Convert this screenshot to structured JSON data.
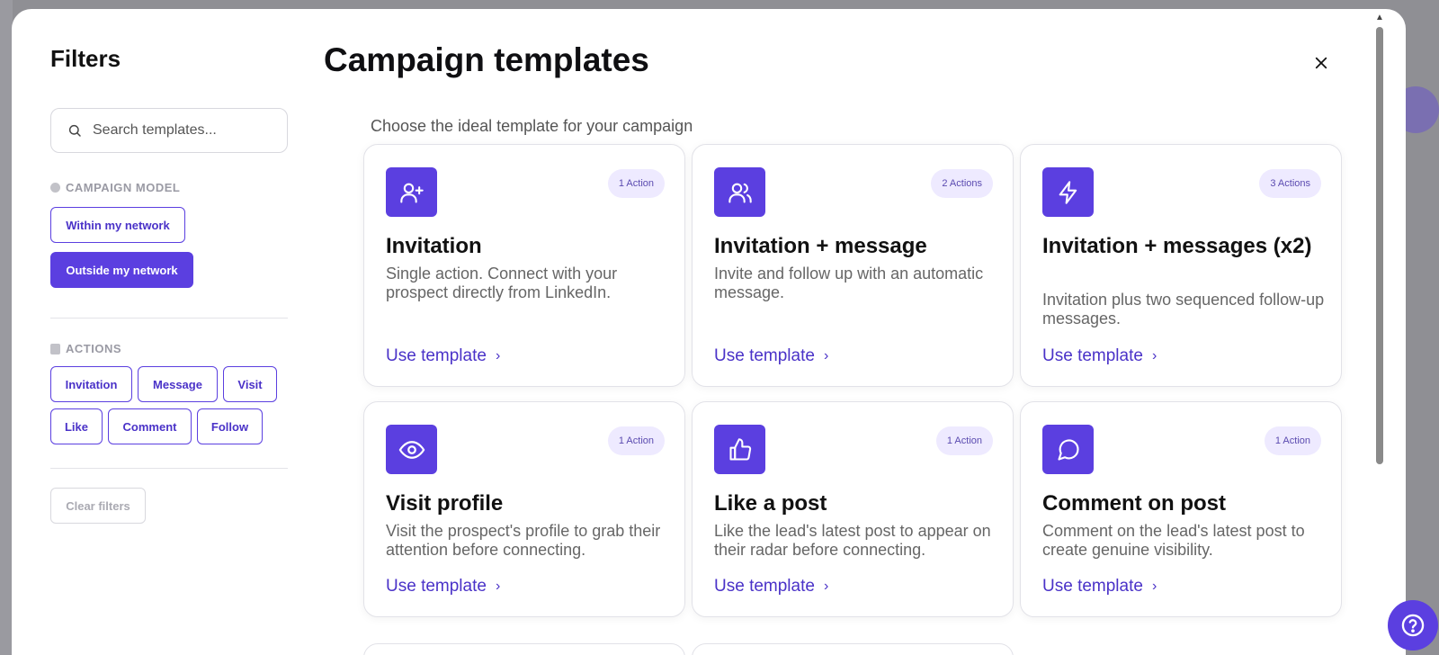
{
  "sidebar": {
    "title": "Filters",
    "search_placeholder": "Search templates...",
    "campaign_model_label": "CAMPAIGN MODEL",
    "campaign_models": [
      {
        "label": "Within my network",
        "active": false
      },
      {
        "label": "Outside my network",
        "active": true
      }
    ],
    "actions_label": "ACTIONS",
    "actions": [
      "Invitation",
      "Message",
      "Visit",
      "Like",
      "Comment",
      "Follow"
    ],
    "clear_label": "Clear filters"
  },
  "main": {
    "title": "Campaign templates",
    "subtitle": "Choose the ideal template for your campaign",
    "cards": [
      {
        "icon": "user-plus-icon",
        "badge": "1 Action",
        "title": "Invitation",
        "description": "Single action. Connect with your prospect directly from LinkedIn.",
        "link": "Use template"
      },
      {
        "icon": "users-icon",
        "badge": "2 Actions",
        "title": "Invitation + message",
        "description": "Invite and follow up with an automatic message.",
        "link": "Use template"
      },
      {
        "icon": "lightning-icon",
        "badge": "3 Actions",
        "title": "Invitation + messages (x2)",
        "description": "Invitation plus two sequenced follow-up messages.",
        "link": "Use template"
      },
      {
        "icon": "eye-icon",
        "badge": "1 Action",
        "title": "Visit profile",
        "description": "Visit the prospect's profile to grab their attention before connecting.",
        "link": "Use template"
      },
      {
        "icon": "thumbs-up-icon",
        "badge": "1 Action",
        "title": "Like a post",
        "description": "Like the lead's latest post to appear on their radar before connecting.",
        "link": "Use template"
      },
      {
        "icon": "comment-icon",
        "badge": "1 Action",
        "title": "Comment on post",
        "description": "Comment on the lead's latest post to create genuine visibility.",
        "link": "Use template"
      }
    ]
  },
  "colors": {
    "accent": "#5b3fe0",
    "badge_bg": "#eeeaff",
    "link": "#4a32c8"
  }
}
